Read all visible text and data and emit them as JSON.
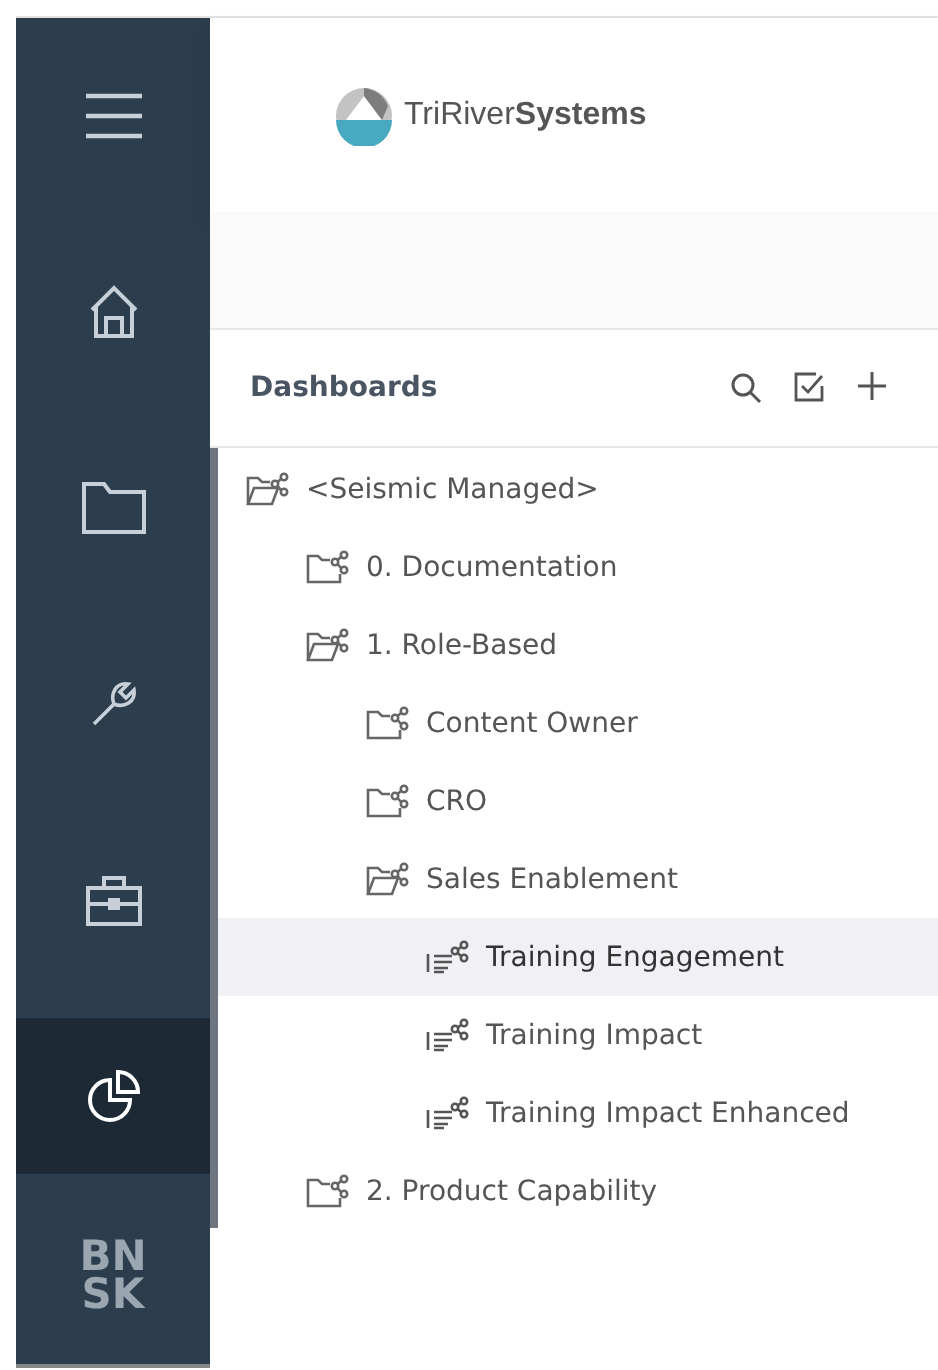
{
  "sidebar": {
    "items": [
      {
        "kind": "menu",
        "selected": false
      },
      {
        "kind": "home",
        "selected": false
      },
      {
        "kind": "folder",
        "selected": false
      },
      {
        "kind": "wrench",
        "selected": false
      },
      {
        "kind": "briefcase",
        "selected": false
      },
      {
        "kind": "chart",
        "selected": true
      }
    ],
    "logo_lines": [
      "BN",
      "SK"
    ]
  },
  "header": {
    "brand": "TriRiver**Systems**"
  },
  "panel": {
    "title": "Dashboards",
    "tree": [
      {
        "label": "<Seismic Managed>",
        "kind": "folder",
        "expanded": true,
        "selected": false,
        "children": [
          {
            "label": "0. Documentation",
            "kind": "folder",
            "expanded": false,
            "selected": false
          },
          {
            "label": "1. Role-Based",
            "kind": "folder",
            "expanded": true,
            "selected": false,
            "children": [
              {
                "label": "Content Owner",
                "kind": "folder",
                "expanded": false,
                "selected": false
              },
              {
                "label": "CRO",
                "kind": "folder",
                "expanded": false,
                "selected": false
              },
              {
                "label": "Sales Enablement",
                "kind": "folder",
                "expanded": true,
                "selected": false,
                "children": [
                  {
                    "label": "Training Engagement",
                    "kind": "dashboard",
                    "selected": true
                  },
                  {
                    "label": "Training Impact",
                    "kind": "dashboard",
                    "selected": false
                  },
                  {
                    "label": "Training Impact Enhanced",
                    "kind": "dashboard",
                    "selected": false
                  }
                ]
              }
            ]
          },
          {
            "label": "2. Product Capability",
            "kind": "folder",
            "expanded": false,
            "selected": false
          }
        ]
      }
    ]
  }
}
